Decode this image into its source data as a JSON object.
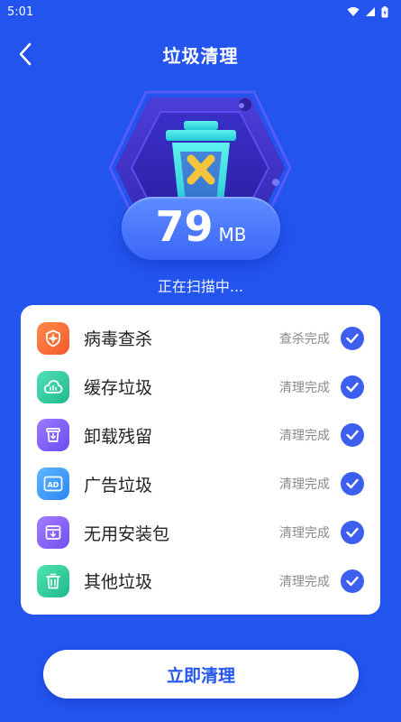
{
  "status_bar": {
    "time": "5:01"
  },
  "header": {
    "title": "垃圾清理"
  },
  "scan": {
    "size_value": "79",
    "size_unit": "MB",
    "status_text": "正在扫描中..."
  },
  "items": [
    {
      "label": "病毒查杀",
      "status": "查杀完成",
      "icon": "shield-virus-icon",
      "color_from": "#ff8a4c",
      "color_to": "#f25a2b"
    },
    {
      "label": "缓存垃圾",
      "status": "清理完成",
      "icon": "cloud-cache-icon",
      "color_from": "#4fe0b6",
      "color_to": "#22b990"
    },
    {
      "label": "卸载残留",
      "status": "清理完成",
      "icon": "trash-residue-icon",
      "color_from": "#9a7bff",
      "color_to": "#6a4cf0"
    },
    {
      "label": "广告垃圾",
      "status": "清理完成",
      "icon": "ad-icon",
      "color_from": "#5fb6ff",
      "color_to": "#2a86f5"
    },
    {
      "label": "无用安装包",
      "status": "清理完成",
      "icon": "package-icon",
      "color_from": "#a57dff",
      "color_to": "#7050ee"
    },
    {
      "label": "其他垃圾",
      "status": "清理完成",
      "icon": "trash-other-icon",
      "color_from": "#4fe3b3",
      "color_to": "#1fba8a"
    }
  ],
  "action": {
    "clean_label": "立即清理"
  },
  "colors": {
    "background": "#2354ee",
    "accent": "#3d5ff0",
    "trash_cross": "#f2c53c"
  }
}
